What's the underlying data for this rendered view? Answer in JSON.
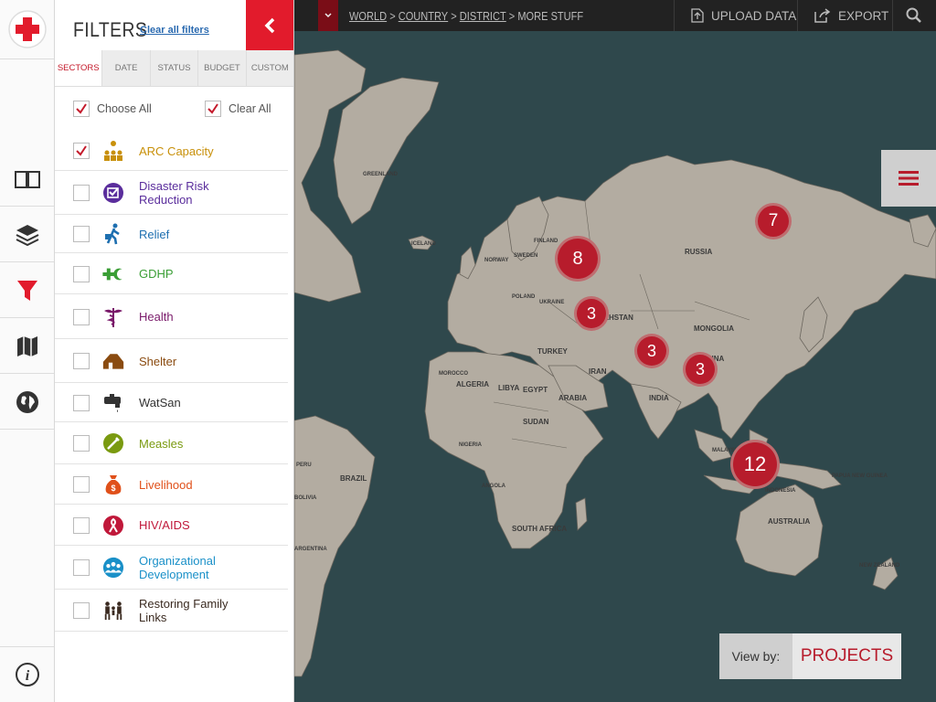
{
  "panel": {
    "title": "FILTERS",
    "clear_all_filters": "Clear all filters",
    "tabs": [
      "SECTORS",
      "DATE",
      "STATUS",
      "BUDGET",
      "CUSTOM"
    ],
    "choose_all": "Choose All",
    "clear_all": "Clear All",
    "sectors": [
      {
        "label": "ARC Capacity",
        "color": "#c8900a",
        "checked": true,
        "icon": "people-hierarchy-icon"
      },
      {
        "label": "Disaster Risk Reduction",
        "color": "#5a2d9c",
        "checked": false,
        "icon": "checkbox-badge-icon"
      },
      {
        "label": "Relief",
        "color": "#1e6fb0",
        "checked": false,
        "icon": "person-carrying-icon"
      },
      {
        "label": "GDHP",
        "color": "#3a9e35",
        "checked": false,
        "icon": "cross-crescent-icon"
      },
      {
        "label": "Health",
        "color": "#7a1a6a",
        "checked": false,
        "icon": "caduceus-icon"
      },
      {
        "label": "Shelter",
        "color": "#8a4b10",
        "checked": false,
        "icon": "house-icon"
      },
      {
        "label": "WatSan",
        "color": "#333333",
        "checked": false,
        "icon": "faucet-icon"
      },
      {
        "label": "Measles",
        "color": "#7a9a10",
        "checked": false,
        "icon": "syringe-icon"
      },
      {
        "label": "Livelihood",
        "color": "#e0501a",
        "checked": false,
        "icon": "money-bag-icon"
      },
      {
        "label": "HIV/AIDS",
        "color": "#c0183a",
        "checked": false,
        "icon": "ribbon-icon"
      },
      {
        "label": "Organizational Development",
        "color": "#1a90c8",
        "checked": false,
        "icon": "people-circle-icon"
      },
      {
        "label": "Restoring Family Links",
        "color": "#3a2a20",
        "checked": false,
        "icon": "family-icon"
      }
    ]
  },
  "topbar": {
    "breadcrumb": [
      "WORLD",
      "COUNTRY",
      "DISTRICT",
      "MORE STUFF"
    ],
    "upload": "UPLOAD DATA",
    "export": "EXPORT"
  },
  "clusters": [
    8,
    7,
    3,
    3,
    3,
    12
  ],
  "map_labels": [
    "RUSSIA",
    "KAZAKHSTAN",
    "MONGOLIA",
    "CHINA",
    "INDIA",
    "AUSTRALIA",
    "BRAZIL",
    "ALGERIA",
    "LIBYA",
    "EGYPT",
    "SUDAN",
    "ARABIA",
    "IRAN",
    "TURKEY",
    "SOUTH AFRICA",
    "GREENLAND",
    "ICELAND",
    "FINLAND",
    "SWEDEN",
    "NORWAY",
    "POLAND",
    "UKRAINE",
    "MALAYSIA",
    "INDONESIA",
    "PAPUA NEW GUINEA",
    "NEW ZEALAND",
    "NIGERIA",
    "ANGOLA",
    "MOROCCO",
    "BOLIVIA",
    "ARGENTINA",
    "PERU"
  ],
  "view_by": {
    "label": "View by:",
    "value": "PROJECTS"
  }
}
